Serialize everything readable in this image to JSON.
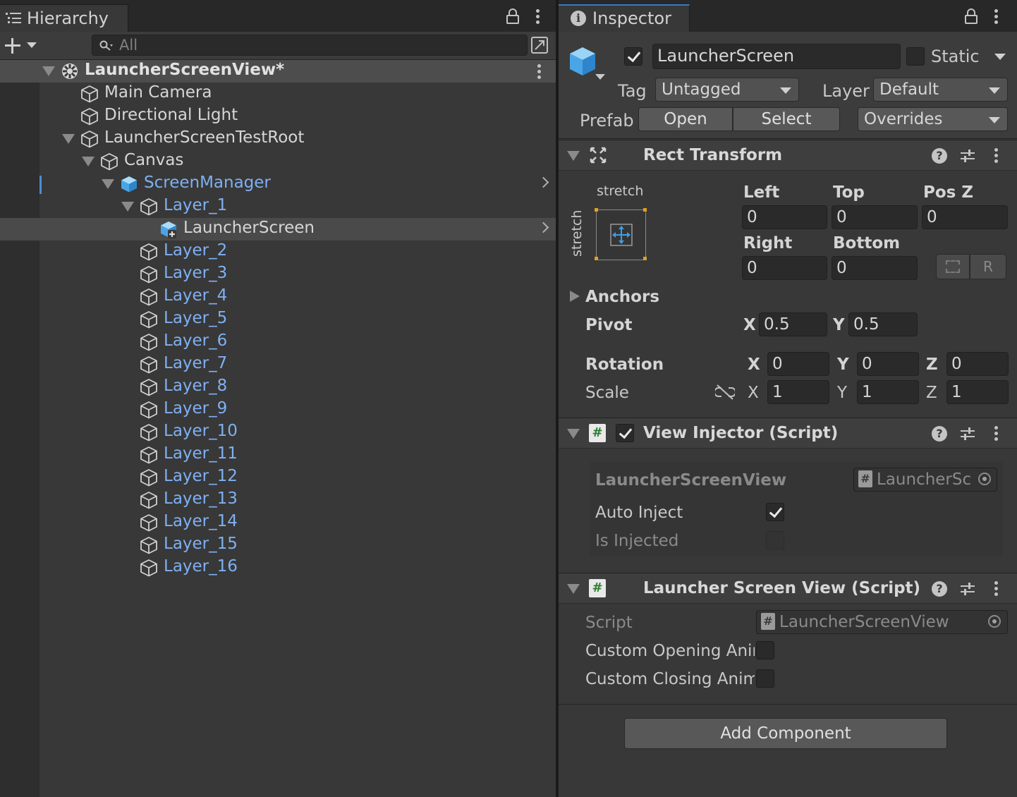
{
  "hierarchy": {
    "tab_label": "Hierarchy",
    "search_placeholder": "All",
    "rows": [
      {
        "label": "LauncherScreenView*",
        "depth": 0,
        "expanded": true,
        "icon": "unity-scene-icon",
        "style": "bold",
        "row": "header",
        "menu": true
      },
      {
        "label": "Main Camera",
        "depth": 1,
        "icon": "gameobject-icon",
        "style": "white"
      },
      {
        "label": "Directional Light",
        "depth": 1,
        "icon": "gameobject-icon",
        "style": "white"
      },
      {
        "label": "LauncherScreenTestRoot",
        "depth": 1,
        "expanded": true,
        "icon": "gameobject-icon",
        "style": "white"
      },
      {
        "label": "Canvas",
        "depth": 2,
        "expanded": true,
        "icon": "gameobject-icon",
        "style": "white"
      },
      {
        "label": "ScreenManager",
        "depth": 3,
        "expanded": true,
        "icon": "prefab-icon",
        "style": "blue",
        "chevron": true
      },
      {
        "label": "Layer_1",
        "depth": 4,
        "expanded": true,
        "icon": "gameobject-icon",
        "style": "blue"
      },
      {
        "label": "LauncherScreen",
        "depth": 5,
        "icon": "prefab-added-icon",
        "style": "white",
        "row": "selected",
        "chevron": true
      },
      {
        "label": "Layer_2",
        "depth": 4,
        "icon": "gameobject-icon",
        "style": "blue"
      },
      {
        "label": "Layer_3",
        "depth": 4,
        "icon": "gameobject-icon",
        "style": "blue"
      },
      {
        "label": "Layer_4",
        "depth": 4,
        "icon": "gameobject-icon",
        "style": "blue"
      },
      {
        "label": "Layer_5",
        "depth": 4,
        "icon": "gameobject-icon",
        "style": "blue"
      },
      {
        "label": "Layer_6",
        "depth": 4,
        "icon": "gameobject-icon",
        "style": "blue"
      },
      {
        "label": "Layer_7",
        "depth": 4,
        "icon": "gameobject-icon",
        "style": "blue"
      },
      {
        "label": "Layer_8",
        "depth": 4,
        "icon": "gameobject-icon",
        "style": "blue"
      },
      {
        "label": "Layer_9",
        "depth": 4,
        "icon": "gameobject-icon",
        "style": "blue"
      },
      {
        "label": "Layer_10",
        "depth": 4,
        "icon": "gameobject-icon",
        "style": "blue"
      },
      {
        "label": "Layer_11",
        "depth": 4,
        "icon": "gameobject-icon",
        "style": "blue"
      },
      {
        "label": "Layer_12",
        "depth": 4,
        "icon": "gameobject-icon",
        "style": "blue"
      },
      {
        "label": "Layer_13",
        "depth": 4,
        "icon": "gameobject-icon",
        "style": "blue"
      },
      {
        "label": "Layer_14",
        "depth": 4,
        "icon": "gameobject-icon",
        "style": "blue"
      },
      {
        "label": "Layer_15",
        "depth": 4,
        "icon": "gameobject-icon",
        "style": "blue"
      },
      {
        "label": "Layer_16",
        "depth": 4,
        "icon": "gameobject-icon",
        "style": "blue"
      }
    ]
  },
  "inspector": {
    "tab_label": "Inspector",
    "object": {
      "active": true,
      "name": "LauncherScreen",
      "static_label": "Static",
      "static_checked": false,
      "tag_label": "Tag",
      "tag_value": "Untagged",
      "layer_label": "Layer",
      "layer_value": "Default",
      "prefab_label": "Prefab",
      "open_label": "Open",
      "select_label": "Select",
      "overrides_label": "Overrides"
    },
    "rect_transform": {
      "title": "Rect Transform",
      "anchor_h": "stretch",
      "anchor_v": "stretch",
      "left_label": "Left",
      "left": "0",
      "top_label": "Top",
      "top": "0",
      "posz_label": "Pos Z",
      "posz": "0",
      "right_label": "Right",
      "right": "0",
      "bottom_label": "Bottom",
      "bottom": "0",
      "raw_button": "R",
      "anchors_label": "Anchors",
      "pivot_label": "Pivot",
      "pivot_x": "0.5",
      "pivot_y": "0.5",
      "rotation_label": "Rotation",
      "rot_x": "0",
      "rot_y": "0",
      "rot_z": "0",
      "scale_label": "Scale",
      "scale_x": "1",
      "scale_y": "1",
      "scale_z": "1",
      "x": "X",
      "y": "Y",
      "z": "Z"
    },
    "view_injector": {
      "title": "View Injector (Script)",
      "enabled": true,
      "field_label": "LauncherScreenView",
      "field_value": "LauncherSc",
      "auto_inject_label": "Auto Inject",
      "auto_inject": true,
      "is_injected_label": "Is Injected",
      "is_injected": false
    },
    "launcher_screen_view": {
      "title": "Launcher Screen View (Script)",
      "script_label": "Script",
      "script_value": "LauncherScreenView",
      "opening_label": "Custom Opening Anin",
      "closing_label": "Custom Closing Anim"
    },
    "add_component_label": "Add Component"
  },
  "colors": {
    "accent_blue": "#7fb0f2",
    "tab_accent": "#3a79bb",
    "panel": "#383838",
    "field": "#2a2a2a"
  }
}
